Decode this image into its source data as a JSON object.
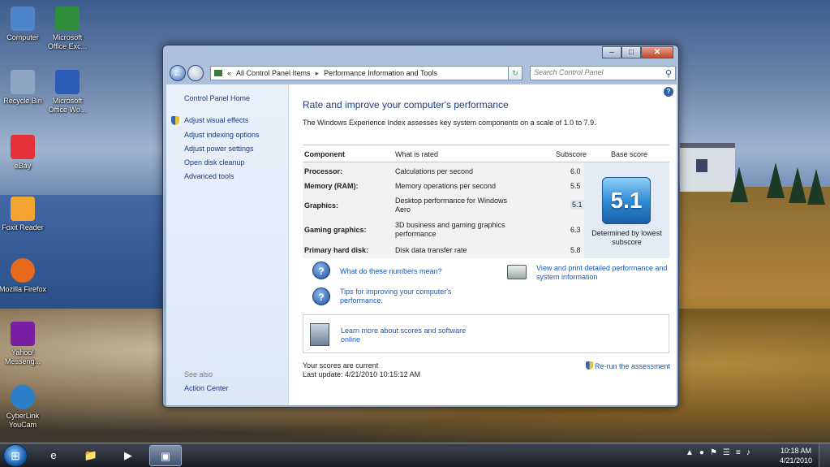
{
  "desktop": {
    "icons": [
      {
        "label": "Computer",
        "icon": "computer-icon",
        "color": "#4e84c9"
      },
      {
        "label": "Microsoft Office Exc...",
        "icon": "excel-icon",
        "color": "#2f8f3a"
      },
      {
        "label": "Recycle Bin",
        "icon": "recycle-bin-icon",
        "color": "#8fa6c2"
      },
      {
        "label": "Microsoft Office Wo...",
        "icon": "word-icon",
        "color": "#2b5cb8"
      },
      {
        "label": "eBay",
        "icon": "ebay-icon",
        "color": "#e53238"
      },
      {
        "label": "Foxit Reader",
        "icon": "foxit-reader-icon",
        "color": "#f3a531"
      },
      {
        "label": "Mozilla Firefox",
        "icon": "firefox-icon",
        "color": "#e66a1c"
      },
      {
        "label": "Yahoo! Messeng...",
        "icon": "yahoo-messenger-icon",
        "color": "#7b1fa2"
      },
      {
        "label": "CyberLink YouCam",
        "icon": "cyberlink-youcam-icon",
        "color": "#2c7fc6"
      }
    ]
  },
  "window": {
    "caption": {
      "minimize": "–",
      "maximize": "□",
      "close": "✕"
    },
    "address": {
      "prefix": "«",
      "crumbs": [
        "All Control Panel Items",
        "Performance Information and Tools"
      ],
      "separator": "▸",
      "dropdown": "▾"
    },
    "search_placeholder": "Search Control Panel",
    "left_pane": {
      "home": "Control Panel Home",
      "items": [
        "Adjust visual effects",
        "Adjust indexing options",
        "Adjust power settings",
        "Open disk cleanup",
        "Advanced tools"
      ],
      "see_also": "See also",
      "action_center": "Action Center"
    },
    "main": {
      "title": "Rate and improve your computer's performance",
      "intro": "The Windows Experience Index assesses key system components on a scale of 1.0 to 7.9.",
      "headers": {
        "component": "Component",
        "what": "What is rated",
        "subscore": "Subscore",
        "base": "Base score"
      },
      "rows": [
        {
          "component": "Processor:",
          "what": "Calculations per second",
          "subscore": "6.0"
        },
        {
          "component": "Memory (RAM):",
          "what": "Memory operations per second",
          "subscore": "5.5"
        },
        {
          "component": "Graphics:",
          "what": "Desktop performance for Windows Aero",
          "subscore": "5.1"
        },
        {
          "component": "Gaming graphics:",
          "what": "3D business and gaming graphics performance",
          "subscore": "6.3"
        },
        {
          "component": "Primary hard disk:",
          "what": "Disk data transfer rate",
          "subscore": "5.8"
        }
      ],
      "base_score": "5.1",
      "base_note": "Determined by lowest subscore",
      "links": {
        "numbers": "What do these numbers mean?",
        "tips": "Tips for improving your computer's performance.",
        "print": "View and print detailed performance and system information",
        "learn": "Learn more about scores and software online"
      },
      "status_line1": "Your scores are current",
      "status_line2": "Last update: 4/21/2010 10:15:12 AM",
      "rerun": "Re-run the assessment"
    }
  },
  "taskbar": {
    "start": "⊞",
    "time": "10:18 AM",
    "date": "4/21/2010",
    "tray": [
      "▲",
      "●",
      "⚑",
      "☰",
      "≡",
      "♪"
    ]
  }
}
